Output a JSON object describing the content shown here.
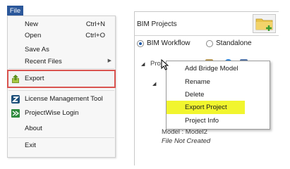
{
  "file_menu": {
    "tab_label": "File",
    "items": [
      {
        "label": "New",
        "shortcut": "Ctrl+N"
      },
      {
        "label": "Open",
        "shortcut": "Ctrl+O"
      },
      {
        "label": "Save As",
        "shortcut": ""
      },
      {
        "label": "Recent Files",
        "shortcut": ""
      },
      {
        "label": "Export",
        "shortcut": ""
      },
      {
        "label": "License Management Tool",
        "shortcut": ""
      },
      {
        "label": "ProjectWise Login",
        "shortcut": ""
      },
      {
        "label": "About",
        "shortcut": ""
      },
      {
        "label": "Exit",
        "shortcut": ""
      }
    ],
    "highlight_color": "#d9534f"
  },
  "bim_panel": {
    "title": "BIM Projects",
    "radio_options": [
      {
        "label": "BIM Workflow",
        "selected": true
      },
      {
        "label": "Standalone",
        "selected": false
      }
    ],
    "tree": {
      "project_label": "Proje",
      "model_label": "Model :  Model2",
      "status_text": "File Not Created"
    },
    "context_menu": {
      "items": [
        "Add Bridge Model",
        "Rename",
        "Delete",
        "Export Project",
        "Project Info"
      ],
      "highlighted": "Export Project",
      "highlight_color": "#f1f52e"
    }
  }
}
